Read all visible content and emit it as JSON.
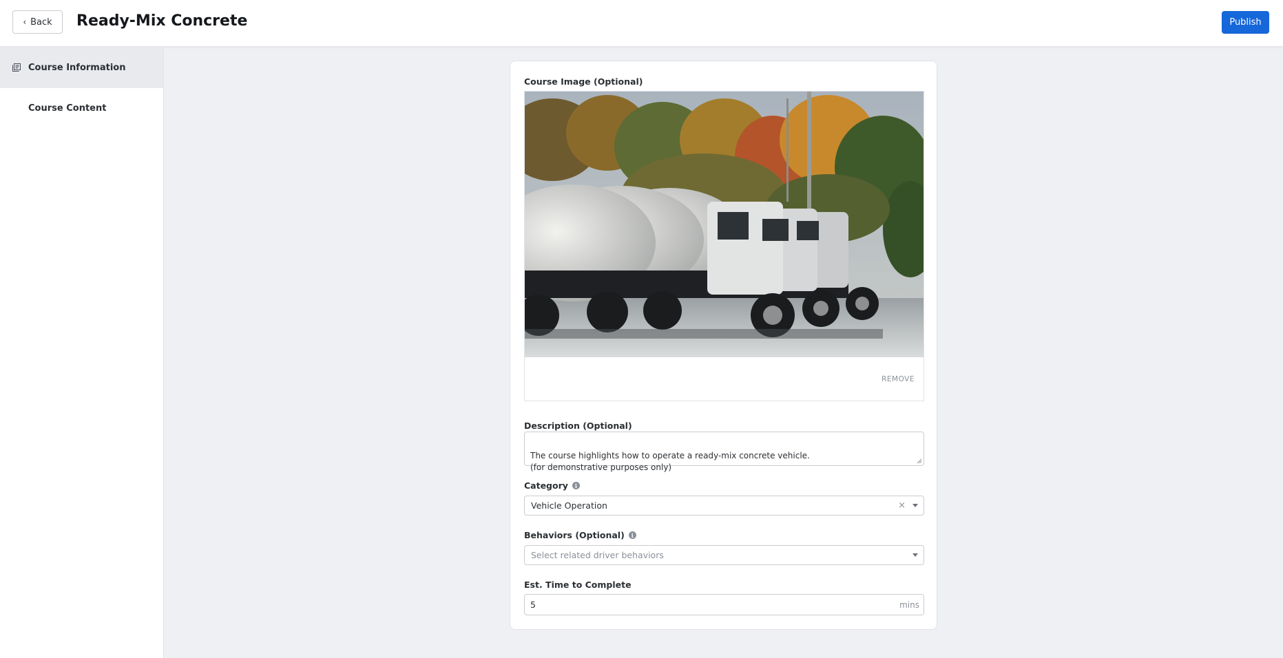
{
  "header": {
    "back_label": "Back",
    "title": "Ready-Mix Concrete",
    "publish_label": "Publish",
    "publish_color": "#1667d9"
  },
  "sidebar": {
    "items": [
      {
        "label": "Course Information",
        "icon": "course-info-icon",
        "active": true
      },
      {
        "label": "Course Content",
        "active": false
      }
    ]
  },
  "form": {
    "image": {
      "label": "Course Image (Optional)",
      "remove_label": "REMOVE"
    },
    "description": {
      "label": "Description (Optional)",
      "value": "The course highlights how to operate a ready-mix concrete vehicle.\n(for demonstrative purposes only)"
    },
    "category": {
      "label": "Category",
      "value": "Vehicle Operation",
      "clear_symbol": "×"
    },
    "behaviors": {
      "label": "Behaviors (Optional)",
      "placeholder": "Select related driver behaviors"
    },
    "time": {
      "label": "Est. Time to Complete",
      "value": "5",
      "unit": "mins"
    }
  }
}
